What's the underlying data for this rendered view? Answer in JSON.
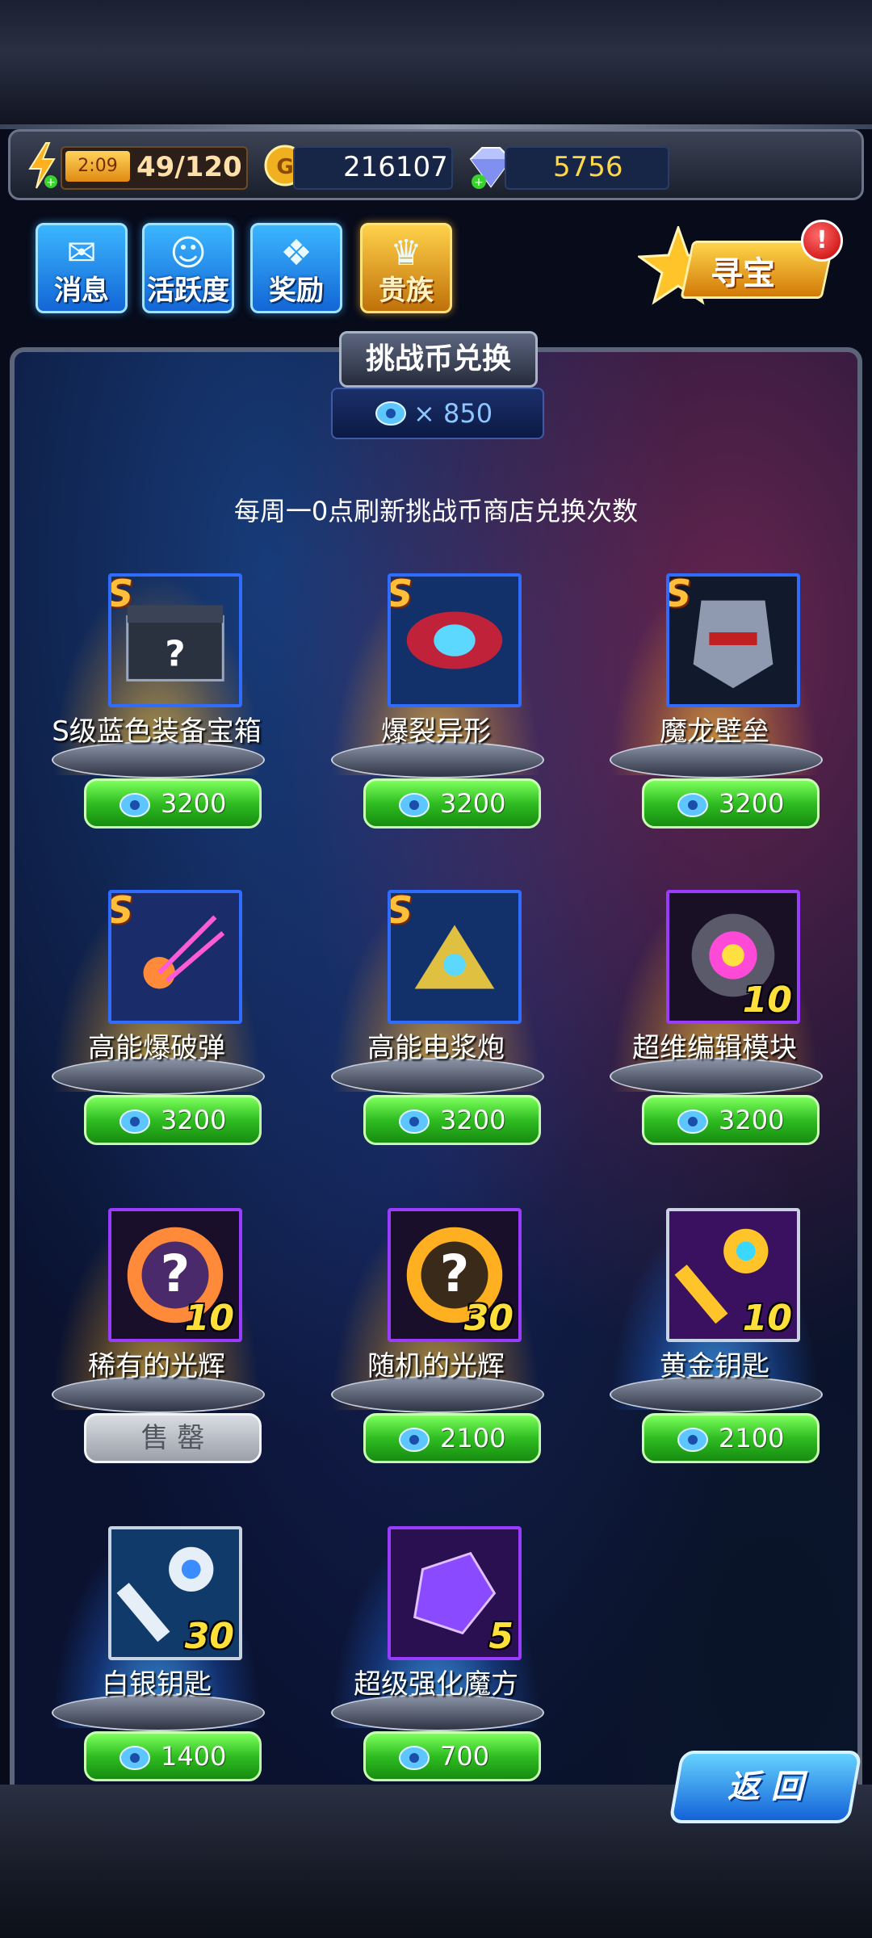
{
  "resources": {
    "energy_timer": "2:09",
    "energy": "49/120",
    "gold": "216107",
    "gems": "5756"
  },
  "menu": {
    "messages": "消息",
    "activity": "活跃度",
    "rewards": "奖励",
    "vip": "贵族",
    "treasure": "寻宝",
    "treasure_badge": "!"
  },
  "shop": {
    "title": "挑战币兑换",
    "currency_amount": "× 850",
    "notice": "每周一0点刷新挑战币商店兑换次数",
    "items": [
      {
        "name": "S级蓝色装备宝箱",
        "grade": "S",
        "qty": "",
        "price": "3200",
        "sold": false
      },
      {
        "name": "爆裂异形",
        "grade": "S",
        "qty": "",
        "price": "3200",
        "sold": false
      },
      {
        "name": "魔龙壁垒",
        "grade": "S",
        "qty": "",
        "price": "3200",
        "sold": false
      },
      {
        "name": "高能爆破弹",
        "grade": "S",
        "qty": "",
        "price": "3200",
        "sold": false
      },
      {
        "name": "高能电浆炮",
        "grade": "S",
        "qty": "",
        "price": "3200",
        "sold": false
      },
      {
        "name": "超维编辑模块",
        "grade": "",
        "qty": "10",
        "price": "3200",
        "sold": false
      },
      {
        "name": "稀有的光辉",
        "grade": "",
        "qty": "10",
        "price": "",
        "sold": true
      },
      {
        "name": "随机的光辉",
        "grade": "",
        "qty": "30",
        "price": "2100",
        "sold": false
      },
      {
        "name": "黄金钥匙",
        "grade": "",
        "qty": "10",
        "price": "2100",
        "sold": false
      },
      {
        "name": "白银钥匙",
        "grade": "",
        "qty": "30",
        "price": "1400",
        "sold": false
      },
      {
        "name": "超级强化魔方",
        "grade": "",
        "qty": "5",
        "price": "700",
        "sold": false
      }
    ],
    "sold_label": "售 罄"
  },
  "back_label": "返 回",
  "colors": {
    "accent_green": "#2fbd22",
    "accent_gold": "#ffbf3a",
    "panel_bg": "#0a1230"
  }
}
